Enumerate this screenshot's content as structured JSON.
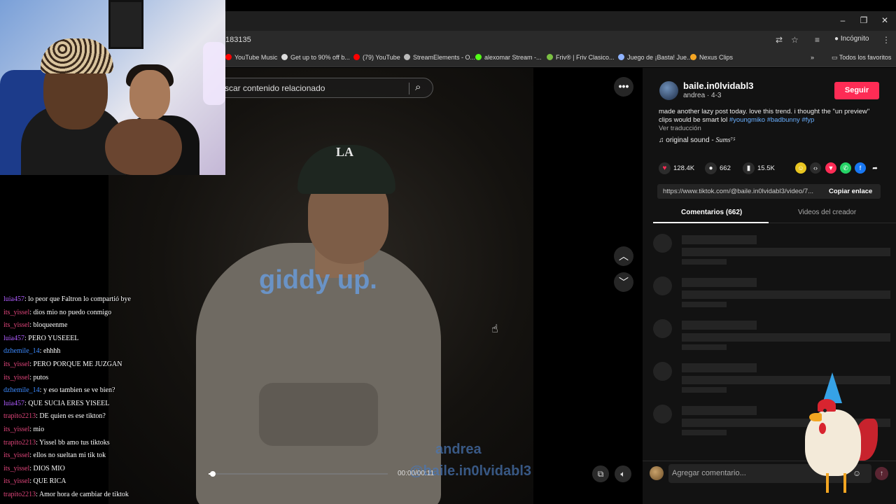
{
  "browser": {
    "url_fragment": "183135",
    "incognito_label": "Incógnito",
    "bookmarks": [
      {
        "label": "YouTube Music",
        "color": "#ff0000"
      },
      {
        "label": "Get up to 90% off b...",
        "color": "#dddddd"
      },
      {
        "label": "(79) YouTube",
        "color": "#ff0000"
      },
      {
        "label": "StreamElements - O...",
        "color": "#bbbbbb"
      },
      {
        "label": "alexomar Stream -...",
        "color": "#53fc18"
      },
      {
        "label": "Friv® | Friv Clasico...",
        "color": "#7bc043"
      },
      {
        "label": "Juego de ¡Basta! Jue...",
        "color": "#8fb3ff"
      },
      {
        "label": "Nexus Clips",
        "color": "#f5a623"
      }
    ],
    "all_bookmarks_label": "Todos los favoritos"
  },
  "video": {
    "search_placeholder": "scar contenido relacionado",
    "overlay_text": "giddy up.",
    "watermark_name": "andrea",
    "watermark_handle": "@baile.in0lvidabl3",
    "cap_logo": "LA",
    "time": "00:00/00:11",
    "progress": 0.02
  },
  "post": {
    "username": "baile.in0lvidabl3",
    "meta": "andrea · 4-3",
    "follow_label": "Seguir",
    "description": "made another lazy post today. love this trend. i thought the \"un preview\" clips would be smart lol",
    "hashtags": "#youngmiko #badbunny #fyp",
    "translate_label": "Ver traducción",
    "sound_label": "original sound -",
    "sound_artist": "Sums⁷⁵",
    "likes": "128.4K",
    "comments": "662",
    "saves": "15.5K",
    "link": "https://www.tiktok.com/@baile.in0lvidabl3/video/7...",
    "copy_label": "Copiar enlace",
    "tab_comments": "Comentarios (662)",
    "tab_creator": "Videos del creador",
    "comment_placeholder": "Agregar comentario..."
  },
  "colors": {
    "accent": "#fe2c55",
    "hashtag": "#6ab0ff"
  },
  "chat": [
    {
      "user": "luia457",
      "color": "#b05cff",
      "msg": "lo peor que Faltron lo compartió bye"
    },
    {
      "user": "its_yissel",
      "color": "#e0457b",
      "msg": "dios mio no puedo conmigo"
    },
    {
      "user": "its_yissel",
      "color": "#e0457b",
      "msg": "bloqueenme"
    },
    {
      "user": "luia457",
      "color": "#b05cff",
      "msg": "PERO YUSEEEL"
    },
    {
      "user": "dzhemile_14",
      "color": "#3d8bff",
      "msg": "ehhhh"
    },
    {
      "user": "its_yissel",
      "color": "#e0457b",
      "msg": "PERO PORQUE ME JUZGAN"
    },
    {
      "user": "its_yissel",
      "color": "#e0457b",
      "msg": "putos"
    },
    {
      "user": "dzhemile_14",
      "color": "#3d8bff",
      "msg": "y eso tambien se ve bien?"
    },
    {
      "user": "luia457",
      "color": "#b05cff",
      "msg": "QUE SUCIA ERES YISEEL"
    },
    {
      "user": "trapito2213",
      "color": "#e0457b",
      "msg": "DE quien es ese tikton?"
    },
    {
      "user": "its_yissel",
      "color": "#e0457b",
      "msg": "mio"
    },
    {
      "user": "trapito2213",
      "color": "#e0457b",
      "msg": "Yissel bb amo tus tiktoks"
    },
    {
      "user": "its_yissel",
      "color": "#e0457b",
      "msg": "ellos no sueltan mi tik tok"
    },
    {
      "user": "its_yissel",
      "color": "#e0457b",
      "msg": "DIOS MIO"
    },
    {
      "user": "its_yissel",
      "color": "#e0457b",
      "msg": "QUE RICA"
    },
    {
      "user": "trapito2213",
      "color": "#e0457b",
      "msg": "Amor hora de cambiar de tiktok"
    }
  ]
}
